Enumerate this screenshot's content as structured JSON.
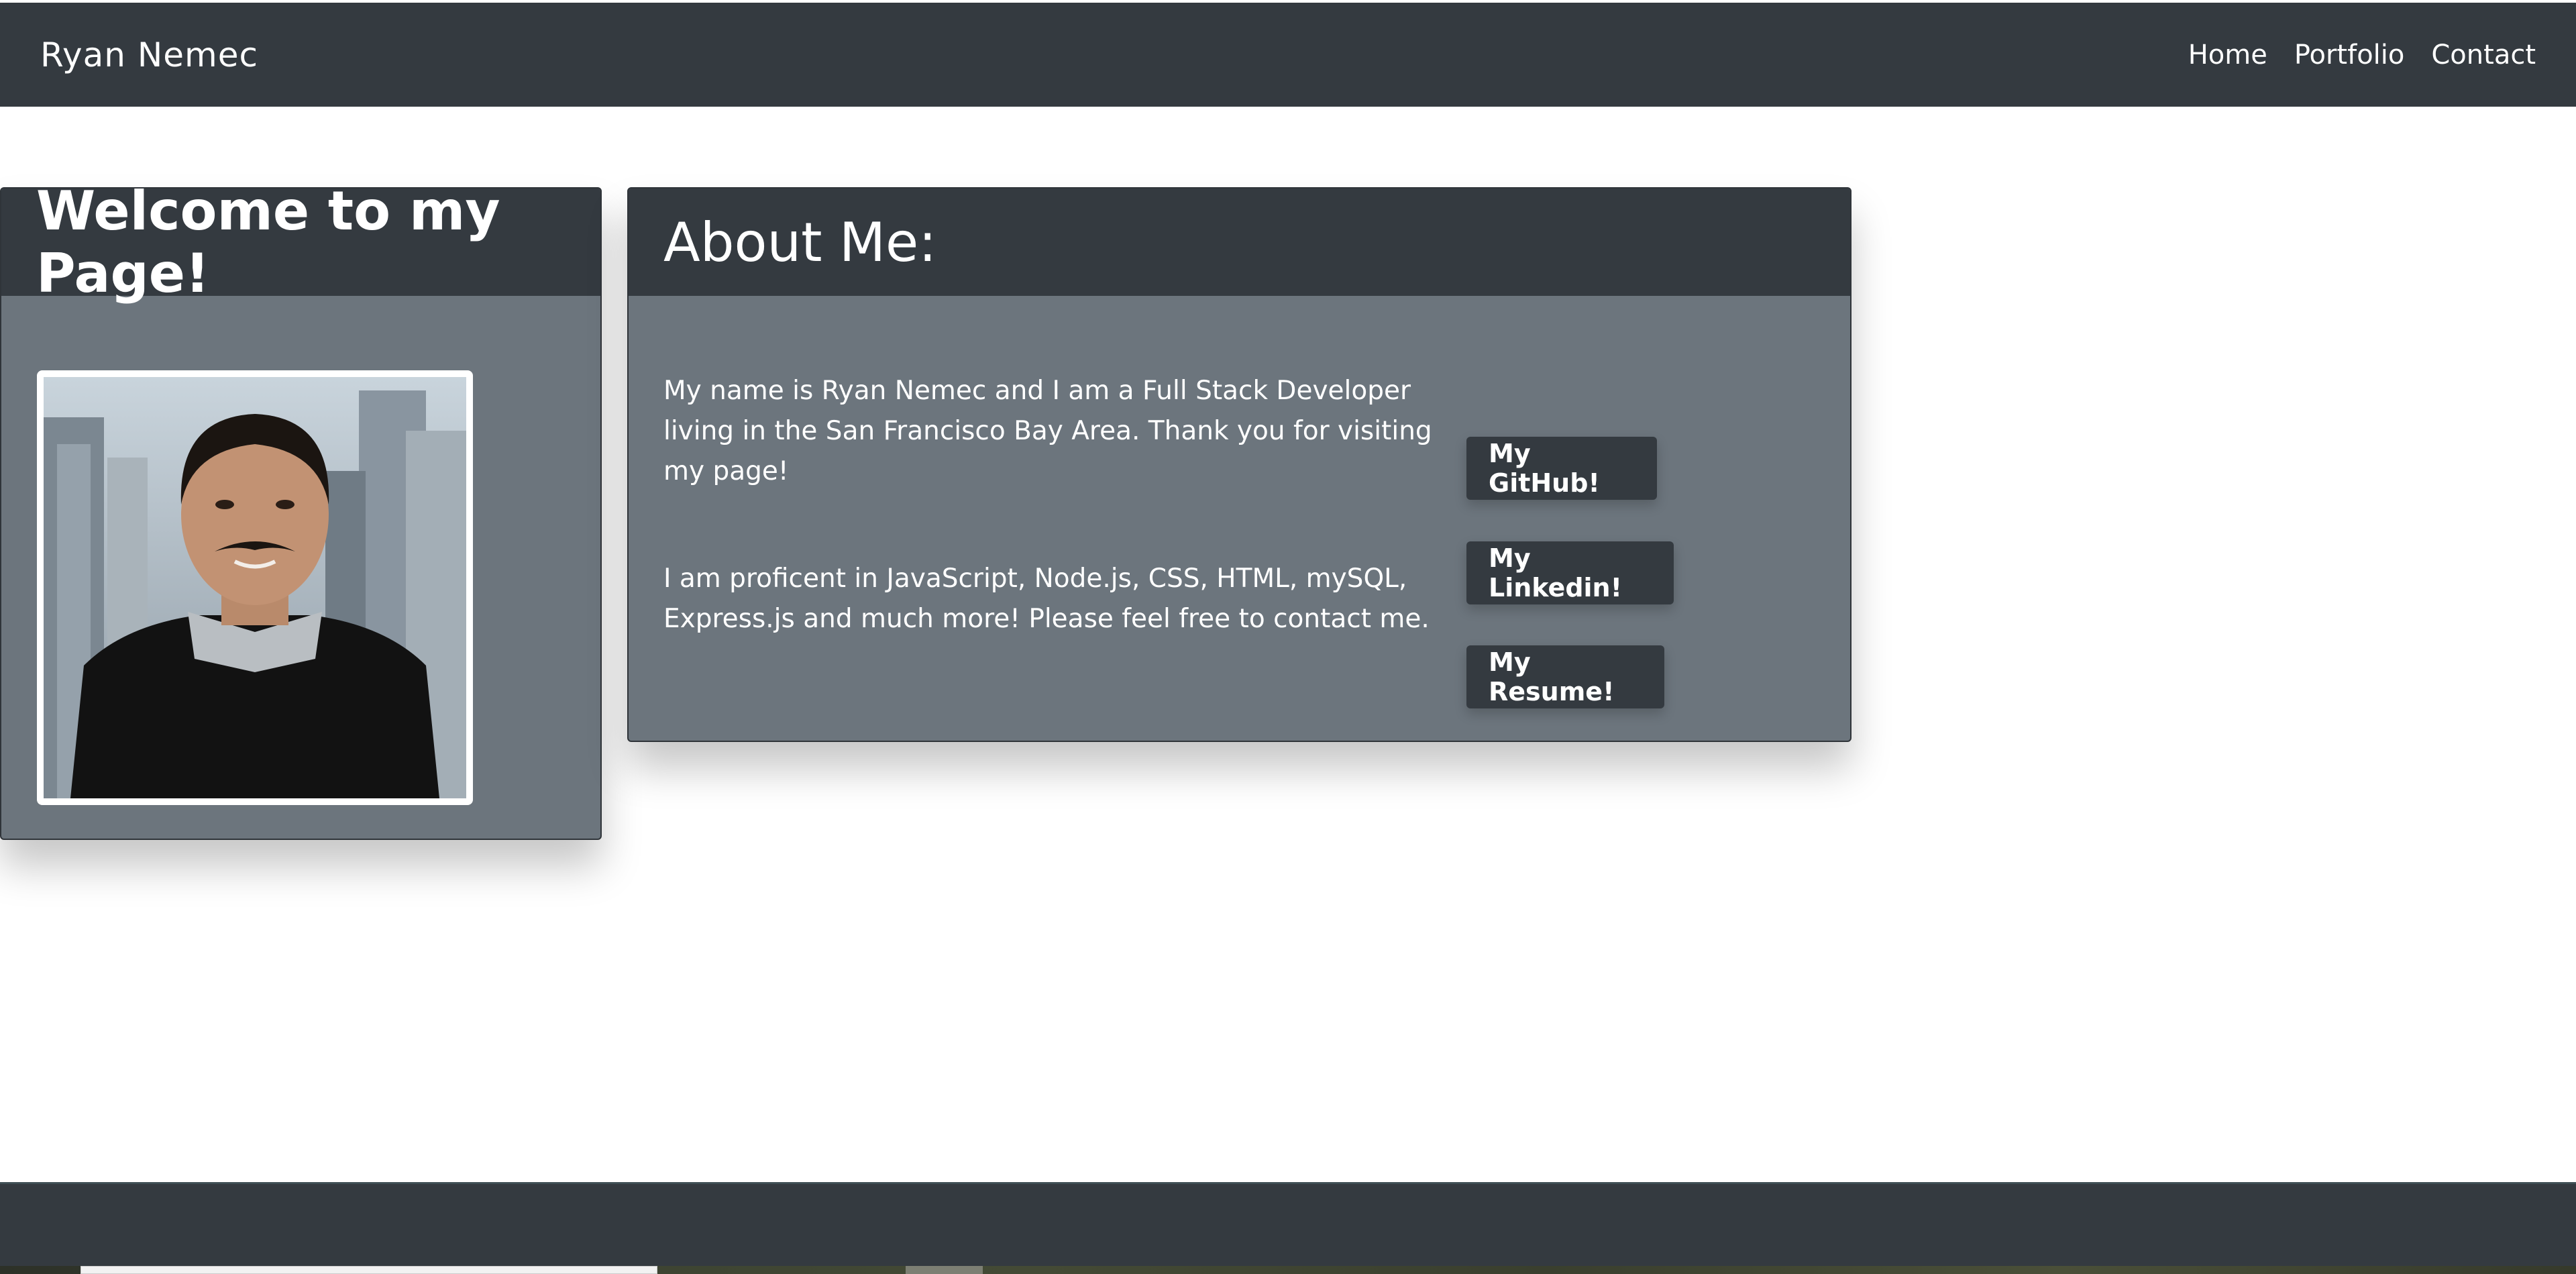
{
  "navbar": {
    "brand": "Ryan Nemec",
    "links": [
      "Home",
      "Portfolio",
      "Contact"
    ]
  },
  "welcome_card": {
    "title": "Welcome to my Page!",
    "photo_alt": "Ryan Nemec"
  },
  "about_card": {
    "title": "About Me:",
    "paragraphs": [
      "My name is Ryan Nemec and I am a Full Stack Developer living in the San Francisco Bay Area. Thank you for visiting my page!",
      "I am proficent in JavaScript, Node.js, CSS, HTML, mySQL, Express.js and much more! Please feel free to contact me."
    ],
    "buttons": {
      "github": "My GitHub!",
      "linkedin": "My Linkedin!",
      "resume": "My Resume!"
    }
  },
  "colors": {
    "navbar": "#343a40",
    "card_body": "#6c757d",
    "button": "#343a40"
  }
}
